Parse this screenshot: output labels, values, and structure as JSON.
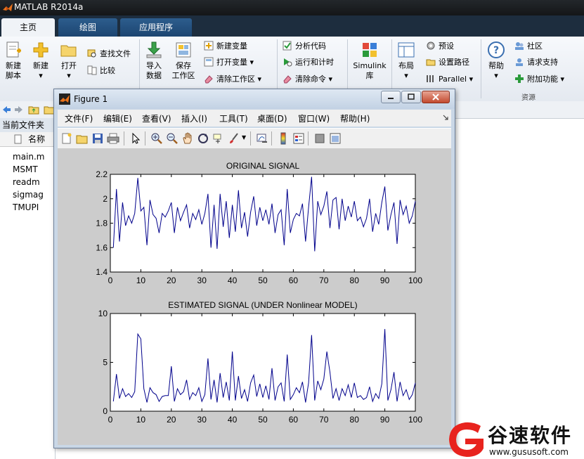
{
  "app": {
    "title": "MATLAB R2014a"
  },
  "tabs": [
    {
      "label": "主页",
      "active": true
    },
    {
      "label": "绘图",
      "active": false
    },
    {
      "label": "应用程序",
      "active": false
    }
  ],
  "ribbon": {
    "new_script": [
      "新建",
      "脚本"
    ],
    "new": "新建",
    "open": "打开",
    "find_files": "查找文件",
    "compare": "比较",
    "import_data": [
      "导入",
      "数据"
    ],
    "save_workspace": [
      "保存",
      "工作区"
    ],
    "new_variable": "新建变量",
    "open_variable": "打开变量",
    "clear_workspace": "清除工作区",
    "analyze_code": "分析代码",
    "run_and_time": "运行和计时",
    "clear_commands": "清除命令",
    "simulink": [
      "Simulink",
      "库"
    ],
    "layout": "布局",
    "preferences": "预设",
    "set_path": "设置路径",
    "parallel": "Parallel",
    "help": "帮助",
    "community": "社区",
    "request_support": "请求支持",
    "add_ons": "附加功能",
    "resources_group": "资源"
  },
  "left_panel": {
    "current_folder": "当前文件夹",
    "name_col": "名称",
    "files": [
      "main.m",
      "MSMT",
      "readm",
      "sigmag",
      "TMUPI"
    ]
  },
  "figure": {
    "title": "Figure 1",
    "menu": [
      "文件(F)",
      "编辑(E)",
      "查看(V)",
      "插入(I)",
      "工具(T)",
      "桌面(D)",
      "窗口(W)",
      "帮助(H)"
    ]
  },
  "chart_data": [
    {
      "type": "line",
      "title": "ORIGINAL SIGNAL",
      "xlim": [
        0,
        100
      ],
      "ylim": [
        1.4,
        2.2
      ],
      "xticks": [
        0,
        10,
        20,
        30,
        40,
        50,
        60,
        70,
        80,
        90,
        100
      ],
      "yticks": [
        1.4,
        1.6,
        1.8,
        2,
        2.2
      ],
      "ytick_labels": [
        "1.4",
        "1.6",
        "1.8",
        "2",
        "2.2"
      ],
      "color": "#00008b",
      "x": [
        1,
        2,
        3,
        4,
        5,
        6,
        7,
        8,
        9,
        10,
        11,
        12,
        13,
        14,
        15,
        16,
        17,
        18,
        19,
        20,
        21,
        22,
        23,
        24,
        25,
        26,
        27,
        28,
        29,
        30,
        31,
        32,
        33,
        34,
        35,
        36,
        37,
        38,
        39,
        40,
        41,
        42,
        43,
        44,
        45,
        46,
        47,
        48,
        49,
        50,
        51,
        52,
        53,
        54,
        55,
        56,
        57,
        58,
        59,
        60,
        61,
        62,
        63,
        64,
        65,
        66,
        67,
        68,
        69,
        70,
        71,
        72,
        73,
        74,
        75,
        76,
        77,
        78,
        79,
        80,
        81,
        82,
        83,
        84,
        85,
        86,
        87,
        88,
        89,
        90,
        91,
        92,
        93,
        94,
        95,
        96,
        97,
        98,
        99,
        100
      ],
      "y": [
        1.6,
        2.08,
        1.65,
        1.97,
        1.78,
        1.86,
        1.8,
        1.88,
        2.17,
        1.9,
        1.93,
        1.62,
        1.99,
        1.87,
        1.84,
        1.72,
        1.88,
        1.85,
        1.9,
        1.97,
        1.72,
        1.93,
        1.82,
        1.89,
        1.95,
        1.76,
        1.88,
        1.83,
        1.91,
        1.79,
        1.88,
        2.04,
        1.6,
        1.95,
        1.59,
        2.04,
        1.77,
        1.98,
        1.68,
        1.95,
        1.73,
        2.07,
        1.76,
        1.89,
        1.69,
        1.89,
        2.02,
        1.78,
        1.93,
        1.82,
        1.91,
        1.79,
        1.96,
        1.72,
        1.87,
        1.91,
        1.62,
        2.08,
        1.72,
        1.83,
        1.88,
        1.86,
        1.96,
        1.65,
        1.93,
        2.18,
        1.57,
        1.98,
        1.87,
        1.94,
        2.06,
        1.76,
        1.99,
        2.01,
        1.75,
        2.0,
        1.82,
        1.94,
        1.85,
        1.98,
        1.82,
        1.85,
        1.77,
        1.84,
        2.0,
        1.73,
        1.88,
        1.79,
        1.97,
        2.1,
        1.74,
        1.87,
        1.97,
        1.63,
        1.99,
        1.87,
        1.94,
        1.8,
        1.86,
        1.98
      ]
    },
    {
      "type": "line",
      "title": "ESTIMATED SIGNAL (UNDER Nonlinear MODEL)",
      "xlim": [
        0,
        100
      ],
      "ylim": [
        0,
        10
      ],
      "xticks": [
        0,
        10,
        20,
        30,
        40,
        50,
        60,
        70,
        80,
        90,
        100
      ],
      "yticks": [
        0,
        5,
        10
      ],
      "ytick_labels": [
        "0",
        "5",
        "10"
      ],
      "color": "#00008b",
      "x": [
        1,
        2,
        3,
        4,
        5,
        6,
        7,
        8,
        9,
        10,
        11,
        12,
        13,
        14,
        15,
        16,
        17,
        18,
        19,
        20,
        21,
        22,
        23,
        24,
        25,
        26,
        27,
        28,
        29,
        30,
        31,
        32,
        33,
        34,
        35,
        36,
        37,
        38,
        39,
        40,
        41,
        42,
        43,
        44,
        45,
        46,
        47,
        48,
        49,
        50,
        51,
        52,
        53,
        54,
        55,
        56,
        57,
        58,
        59,
        60,
        61,
        62,
        63,
        64,
        65,
        66,
        67,
        68,
        69,
        70,
        71,
        72,
        73,
        74,
        75,
        76,
        77,
        78,
        79,
        80,
        81,
        82,
        83,
        84,
        85,
        86,
        87,
        88,
        89,
        90,
        91,
        92,
        93,
        94,
        95,
        96,
        97,
        98,
        99,
        100
      ],
      "y": [
        1.0,
        3.8,
        1.3,
        2.3,
        1.5,
        1.8,
        1.4,
        2.0,
        7.9,
        7.4,
        2.3,
        0.9,
        2.4,
        1.9,
        1.7,
        1.0,
        1.5,
        1.6,
        1.6,
        4.6,
        1.0,
        2.3,
        1.7,
        2.0,
        3.2,
        1.2,
        1.9,
        1.6,
        2.4,
        1.0,
        1.7,
        5.4,
        1.2,
        3.2,
        0.9,
        3.9,
        1.4,
        3.0,
        1.1,
        6.1,
        1.1,
        3.6,
        1.3,
        2.2,
        1.0,
        2.9,
        3.7,
        1.5,
        2.8,
        1.4,
        2.6,
        1.2,
        4.4,
        1.1,
        2.5,
        2.9,
        1.0,
        5.8,
        1.2,
        1.7,
        2.4,
        1.9,
        3.0,
        0.9,
        2.9,
        7.8,
        1.1,
        3.1,
        2.2,
        3.3,
        6.1,
        4.0,
        1.3,
        2.3,
        1.1,
        2.3,
        1.6,
        2.7,
        1.4,
        2.9,
        1.4,
        1.6,
        1.2,
        1.4,
        2.5,
        1.0,
        1.8,
        1.3,
        2.8,
        8.4,
        1.1,
        2.2,
        4.0,
        1.0,
        3.0,
        1.6,
        2.2,
        1.2,
        1.7,
        2.9
      ]
    }
  ],
  "watermark": {
    "text": "谷速软件",
    "url": "www.gususoft.com",
    "brand_color": "#e8231e"
  }
}
